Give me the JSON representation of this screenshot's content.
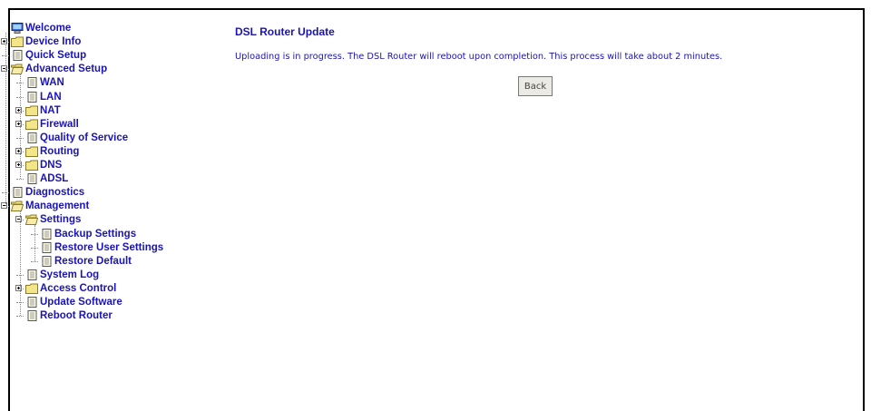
{
  "nav": {
    "items": [
      {
        "label": "Welcome",
        "icon": "computer-icon",
        "level": 0
      },
      {
        "label": "Device Info",
        "icon": "folder-icon",
        "level": 0,
        "expander": "plus"
      },
      {
        "label": "Quick Setup",
        "icon": "page-icon",
        "level": 0
      },
      {
        "label": "Advanced Setup",
        "icon": "folder-open-icon",
        "level": 0,
        "expander": "minus"
      },
      {
        "label": "WAN",
        "icon": "page-icon",
        "level": 1
      },
      {
        "label": "LAN",
        "icon": "page-icon",
        "level": 1
      },
      {
        "label": "NAT",
        "icon": "folder-icon",
        "level": 1,
        "expander": "plus"
      },
      {
        "label": "Firewall",
        "icon": "folder-icon",
        "level": 1,
        "expander": "plus"
      },
      {
        "label": "Quality of Service",
        "icon": "page-icon",
        "level": 1
      },
      {
        "label": "Routing",
        "icon": "folder-icon",
        "level": 1,
        "expander": "plus"
      },
      {
        "label": "DNS",
        "icon": "folder-icon",
        "level": 1,
        "expander": "plus"
      },
      {
        "label": "ADSL",
        "icon": "page-icon",
        "level": 1
      },
      {
        "label": "Diagnostics",
        "icon": "page-icon",
        "level": 0
      },
      {
        "label": "Management",
        "icon": "folder-open-icon",
        "level": 0,
        "expander": "minus"
      },
      {
        "label": "Settings",
        "icon": "folder-open-icon",
        "level": 1,
        "expander": "minus"
      },
      {
        "label": "Backup Settings",
        "icon": "page-icon",
        "level": 2
      },
      {
        "label": "Restore User Settings",
        "icon": "page-icon",
        "level": 2
      },
      {
        "label": "Restore Default",
        "icon": "page-icon",
        "level": 2
      },
      {
        "label": "System Log",
        "icon": "page-icon",
        "level": 1
      },
      {
        "label": "Access Control",
        "icon": "folder-icon",
        "level": 1,
        "expander": "plus"
      },
      {
        "label": "Update Software",
        "icon": "page-icon",
        "level": 1
      },
      {
        "label": "Reboot Router",
        "icon": "page-icon",
        "level": 1
      }
    ]
  },
  "main": {
    "title": "DSL Router Update",
    "message": "Uploading is in progress. The DSL Router will reboot upon completion. This process will take about 2 minutes.",
    "back_label": "Back"
  },
  "colors": {
    "link": "#1a14b8",
    "folder": "#f4e48a",
    "page": "#fffde8"
  }
}
